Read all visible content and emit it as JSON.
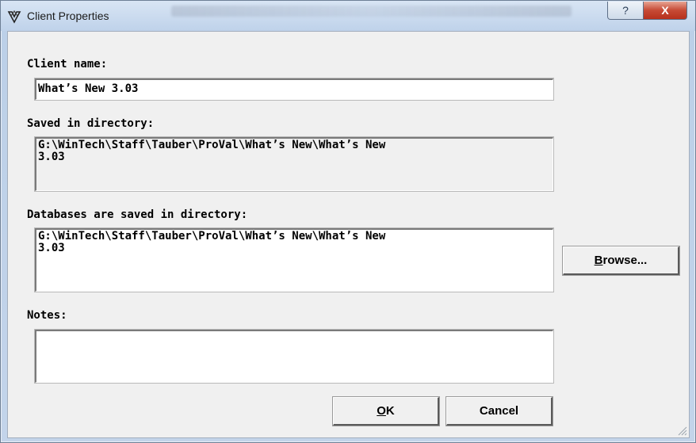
{
  "window": {
    "title": "Client Properties"
  },
  "titlebar": {
    "help_symbol": "?",
    "close_symbol": "X"
  },
  "form": {
    "client_name_label": "Client name:",
    "client_name_value": "What’s New 3.03",
    "saved_dir_label": "Saved in directory:",
    "saved_dir_value": "G:\\WinTech\\Staff\\Tauber\\ProVal\\What’s New\\What’s New\n3.03",
    "db_dir_label": "Databases are saved in directory:",
    "db_dir_value": "G:\\WinTech\\Staff\\Tauber\\ProVal\\What’s New\\What’s New\n3.03",
    "notes_label": "Notes:",
    "notes_value": ""
  },
  "buttons": {
    "browse_mnemonic": "B",
    "browse_rest": "rowse...",
    "ok_mnemonic": "O",
    "ok_rest": "K",
    "cancel": "Cancel"
  },
  "icons": [
    "app-logo-icon",
    "help-icon",
    "close-icon",
    "resize-grip-icon"
  ]
}
